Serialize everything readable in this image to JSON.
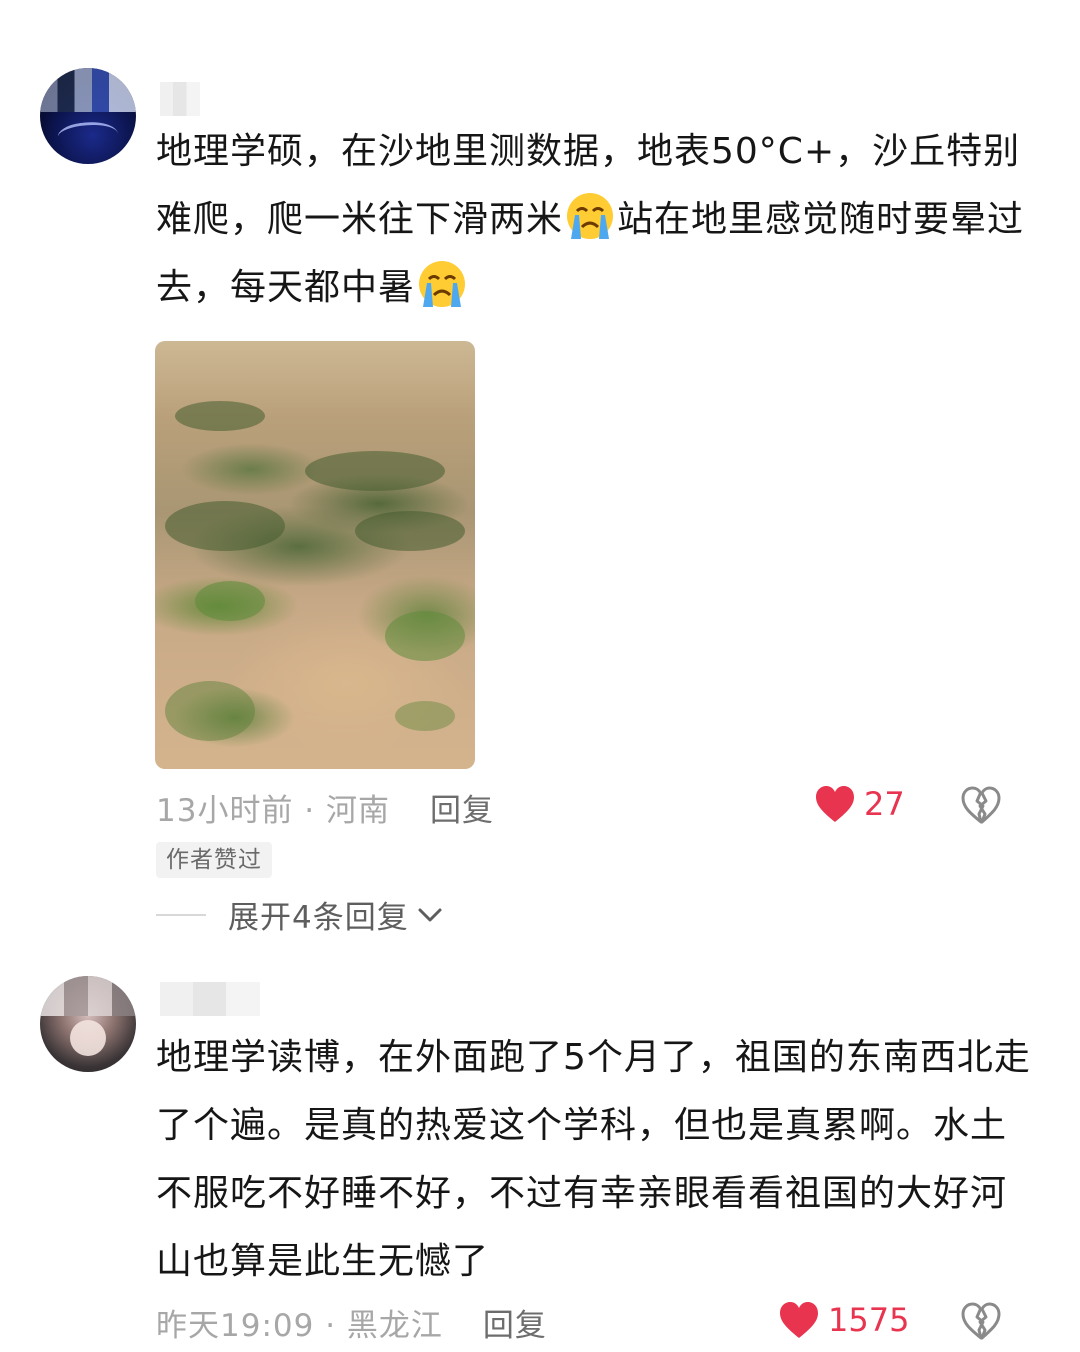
{
  "comments": [
    {
      "text_before_emoji1": "地理学硕，在沙地里测数据，地表50°C+，沙丘特别难爬，爬一米往下滑两米",
      "text_before_emoji2": "站在地里感觉随时要晕过去，每天都中暑",
      "emoji": "crying-face",
      "meta": "13小时前 · 河南",
      "reply": "回复",
      "likes": "27",
      "badge": "作者赞过",
      "expand": "展开4条回复"
    },
    {
      "text": "地理学读博，在外面跑了5个月了，祖国的东南西北走了个遍。是真的热爱这个学科，但也是真累啊。水土不服吃不好睡不好，不过有幸亲眼看看祖国的大好河山也算是此生无憾了",
      "meta": "昨天19:09 · 黑龙江",
      "reply": "回复",
      "likes": "1575"
    }
  ],
  "colors": {
    "like": "#e8344f",
    "meta": "#a7a7a7",
    "text": "#161616"
  }
}
